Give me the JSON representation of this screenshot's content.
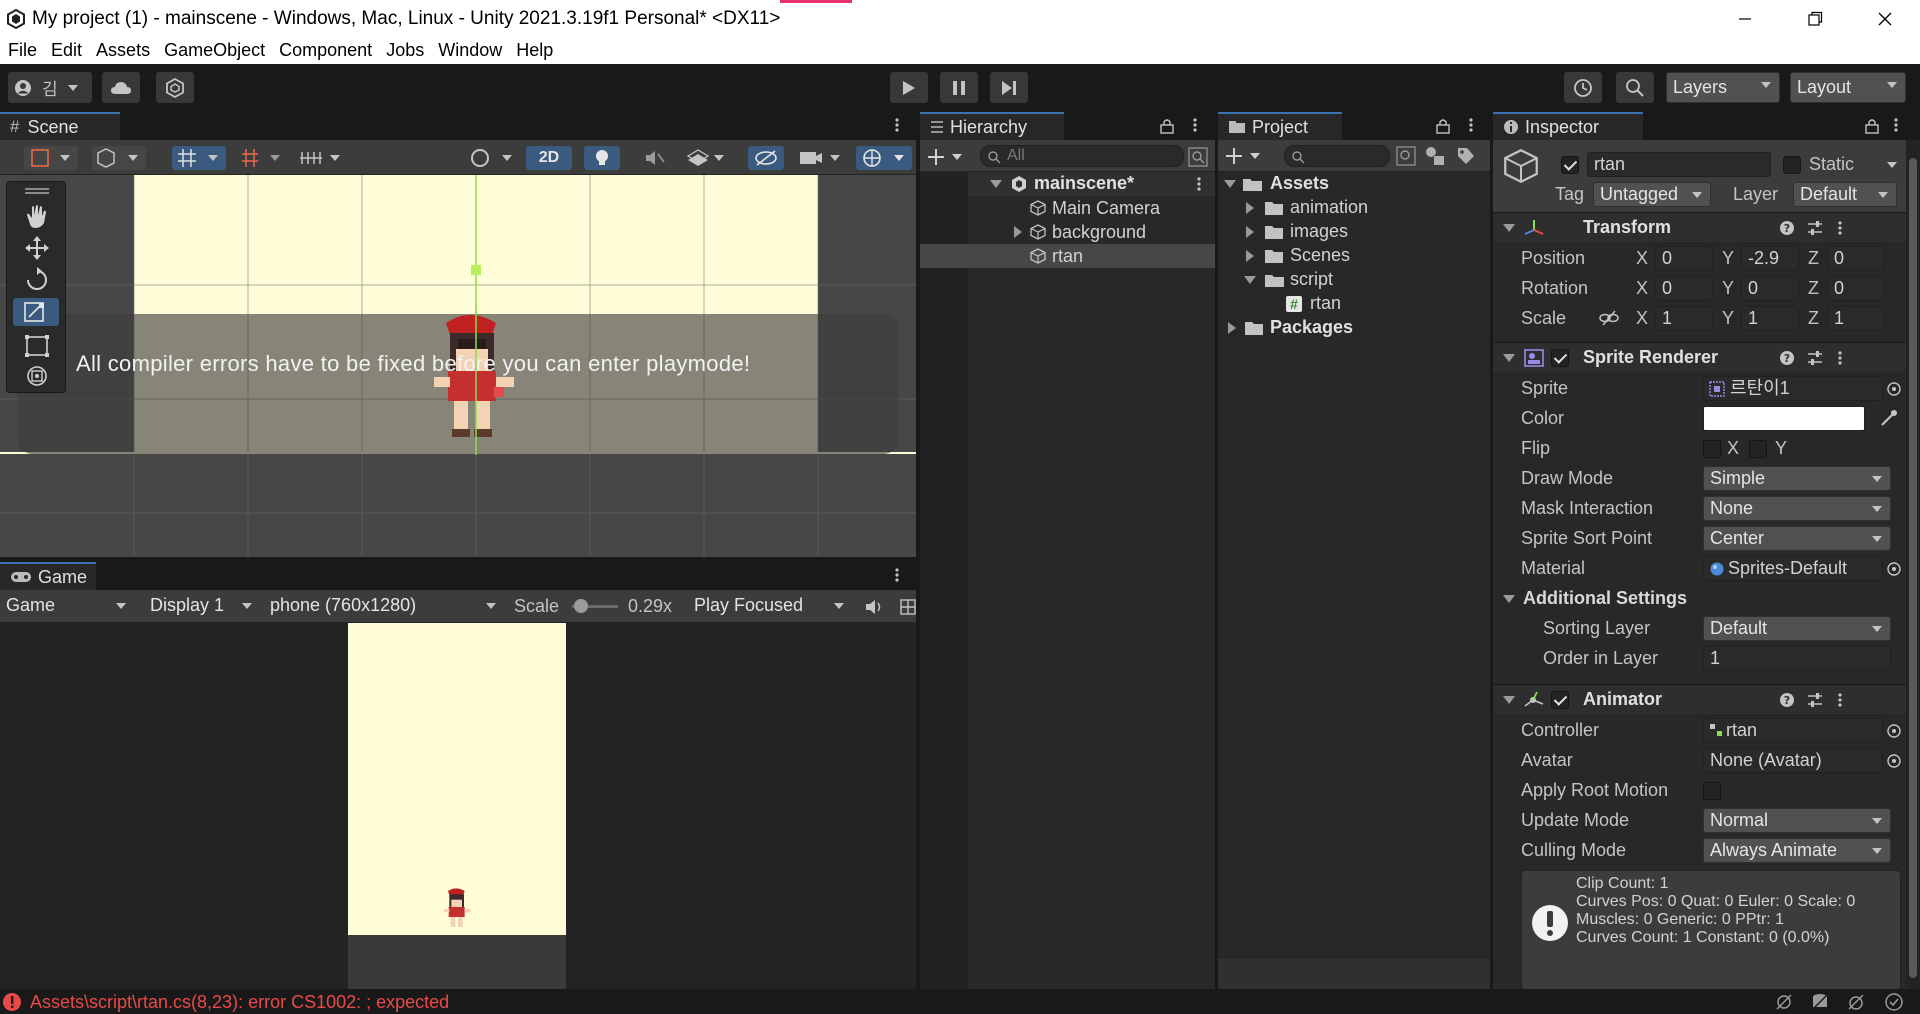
{
  "window": {
    "title": "My project (1) - mainscene - Windows, Mac, Linux - Unity 2021.3.19f1 Personal* <DX11>"
  },
  "menu": [
    "File",
    "Edit",
    "Assets",
    "GameObject",
    "Component",
    "Jobs",
    "Window",
    "Help"
  ],
  "toolbar": {
    "account_initial": "김",
    "layers_label": "Layers",
    "layout_label": "Layout"
  },
  "scene": {
    "tab_label": "Scene",
    "mode_2d": "2D",
    "overlay_message": "All compiler errors have to be fixed before you can enter playmode!"
  },
  "game": {
    "tab_label": "Game",
    "view_select": "Game",
    "display_select": "Display 1",
    "resolution_select": "phone (760x1280)",
    "scale_label": "Scale",
    "scale_value": "0.29x",
    "play_mode_select": "Play Focused"
  },
  "hierarchy": {
    "tab_label": "Hierarchy",
    "search_placeholder": "All",
    "scene_name": "mainscene*",
    "items": [
      "Main Camera",
      "background",
      "rtan"
    ]
  },
  "project": {
    "tab_label": "Project",
    "assets_label": "Assets",
    "folders": [
      "animation",
      "images",
      "Scenes",
      "script"
    ],
    "script_file": "rtan",
    "packages_label": "Packages"
  },
  "inspector": {
    "tab_label": "Inspector",
    "object_name": "rtan",
    "static_label": "Static",
    "tag_label": "Tag",
    "tag_value": "Untagged",
    "layer_label": "Layer",
    "layer_value": "Default",
    "transform": {
      "title": "Transform",
      "position_label": "Position",
      "rotation_label": "Rotation",
      "scale_label": "Scale",
      "position": {
        "x": "0",
        "y": "-2.9",
        "z": "0"
      },
      "rotation": {
        "x": "0",
        "y": "0",
        "z": "0"
      },
      "scale": {
        "x": "1",
        "y": "1",
        "z": "1"
      },
      "axis": {
        "x": "X",
        "y": "Y",
        "z": "Z"
      }
    },
    "sprite_renderer": {
      "title": "Sprite Renderer",
      "sprite_label": "Sprite",
      "sprite_value": "르탄이1",
      "color_label": "Color",
      "color_value": "#ffffff",
      "flip_label": "Flip",
      "flip_x": "X",
      "flip_y": "Y",
      "draw_mode_label": "Draw Mode",
      "draw_mode_value": "Simple",
      "mask_label": "Mask Interaction",
      "mask_value": "None",
      "sort_point_label": "Sprite Sort Point",
      "sort_point_value": "Center",
      "material_label": "Material",
      "material_value": "Sprites-Default",
      "additional_label": "Additional Settings",
      "sorting_layer_label": "Sorting Layer",
      "sorting_layer_value": "Default",
      "order_label": "Order in Layer",
      "order_value": "1"
    },
    "animator": {
      "title": "Animator",
      "controller_label": "Controller",
      "controller_value": "rtan",
      "avatar_label": "Avatar",
      "avatar_value": "None (Avatar)",
      "root_motion_label": "Apply Root Motion",
      "update_mode_label": "Update Mode",
      "update_mode_value": "Normal",
      "culling_label": "Culling Mode",
      "culling_value": "Always Animate",
      "info_lines": [
        "Clip Count: 1",
        "Curves Pos: 0 Quat: 0 Euler: 0 Scale: 0",
        "Muscles: 0 Generic: 0 PPtr: 1",
        "Curves Count: 1 Constant: 0 (0.0%)"
      ]
    }
  },
  "status": {
    "error_message": "Assets\\script\\rtan.cs(8,23): error CS1002: ; expected"
  },
  "colors": {
    "accent_blue": "#3a72b0",
    "error_red": "#e84a4a",
    "scene_bg": "#fffcd8"
  }
}
